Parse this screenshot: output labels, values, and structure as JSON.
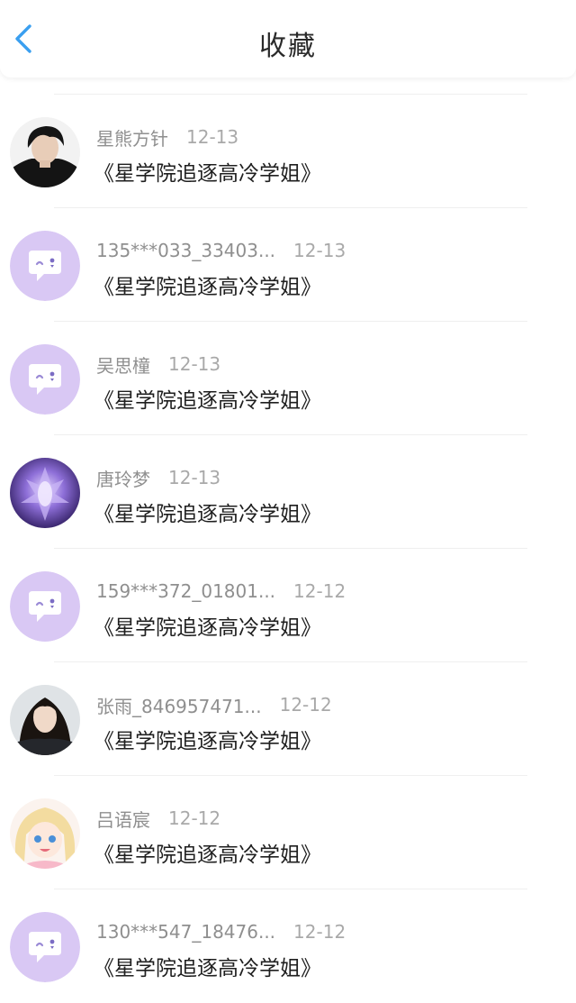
{
  "header": {
    "title": "收藏",
    "back_icon": "chevron-left-icon",
    "accent_color": "#3a9ff0"
  },
  "favorites": [
    {
      "name": "星熊方针",
      "date": "12-13",
      "title": "《星学院追逐高冷学姐》",
      "avatar": "photo-dark-hair-man"
    },
    {
      "name": "135***033_33403...",
      "date": "12-13",
      "title": "《星学院追逐高冷学姐》",
      "avatar": "default-chat-bubble"
    },
    {
      "name": "吴思橦",
      "date": "12-13",
      "title": "《星学院追逐高冷学姐》",
      "avatar": "default-chat-bubble"
    },
    {
      "name": "唐玲梦",
      "date": "12-13",
      "title": "《星学院追逐高冷学姐》",
      "avatar": "purple-fantasy-art"
    },
    {
      "name": "159***372_01801...",
      "date": "12-12",
      "title": "《星学院追逐高冷学姐》",
      "avatar": "default-chat-bubble"
    },
    {
      "name": "张雨_846957471...",
      "date": "12-12",
      "title": "《星学院追逐高冷学姐》",
      "avatar": "photo-woman-portrait"
    },
    {
      "name": "吕语宸",
      "date": "12-12",
      "title": "《星学院追逐高冷学姐》",
      "avatar": "anime-girl-blonde"
    },
    {
      "name": "130***547_18476...",
      "date": "12-12",
      "title": "《星学院追逐高冷学姐》",
      "avatar": "default-chat-bubble"
    }
  ],
  "colors": {
    "default_avatar_bg": "#d9c8f4",
    "name_text": "#8f8f8f",
    "date_text": "#a9a9a9",
    "title_text": "#1f1f1f"
  }
}
